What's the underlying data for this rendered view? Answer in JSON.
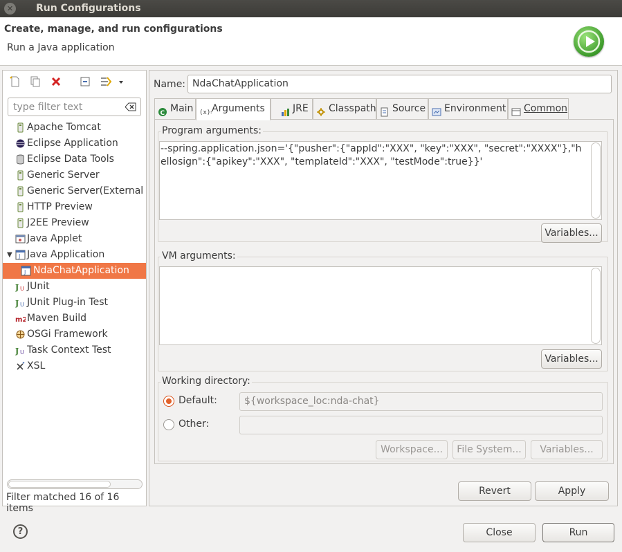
{
  "window": {
    "title": "Run Configurations"
  },
  "header": {
    "title": "Create, manage, and run configurations",
    "subtitle": "Run a Java application",
    "run_icon": "run-icon"
  },
  "left": {
    "toolbar": [
      {
        "name": "new-configuration-icon"
      },
      {
        "name": "duplicate-icon"
      },
      {
        "name": "delete-icon"
      },
      {
        "name": "collapse-all-icon"
      },
      {
        "name": "filter-icon"
      },
      {
        "name": "dropdown-arrow-icon"
      }
    ],
    "filter_placeholder": "type filter text",
    "tree": [
      {
        "label": "Apache Tomcat",
        "icon": "tomcat-icon"
      },
      {
        "label": "Eclipse Application",
        "icon": "eclipse-icon"
      },
      {
        "label": "Eclipse Data Tools",
        "icon": "database-icon"
      },
      {
        "label": "Generic Server",
        "icon": "server-icon"
      },
      {
        "label": "Generic Server(External L",
        "icon": "server-icon"
      },
      {
        "label": "HTTP Preview",
        "icon": "server-icon"
      },
      {
        "label": "J2EE Preview",
        "icon": "server-icon"
      },
      {
        "label": "Java Applet",
        "icon": "applet-icon"
      },
      {
        "label": "Java Application",
        "icon": "java-app-icon",
        "expanded": true
      },
      {
        "label": "NdaChatApplication",
        "icon": "java-app-icon",
        "selected": true,
        "child": true
      },
      {
        "label": "JUnit",
        "icon": "junit-icon"
      },
      {
        "label": "JUnit Plug-in Test",
        "icon": "junit-plugin-icon"
      },
      {
        "label": "Maven Build",
        "icon": "maven-icon"
      },
      {
        "label": "OSGi Framework",
        "icon": "osgi-icon"
      },
      {
        "label": "Task Context Test",
        "icon": "junit-task-icon"
      },
      {
        "label": "XSL",
        "icon": "xsl-icon"
      }
    ],
    "status": "Filter matched 16 of 16 items"
  },
  "right": {
    "name_label": "Name:",
    "name_value": "NdaChatApplication",
    "tabs": [
      {
        "label": "Main",
        "icon": "main-icon"
      },
      {
        "label": "Arguments",
        "icon": "arguments-icon",
        "active": true
      },
      {
        "label": "JRE",
        "icon": "jre-icon"
      },
      {
        "label": "Classpath",
        "icon": "classpath-icon"
      },
      {
        "label": "Source",
        "icon": "source-icon"
      },
      {
        "label": "Environment",
        "icon": "environment-icon"
      },
      {
        "label": "Common",
        "icon": "common-icon"
      }
    ],
    "program_args": {
      "title": "Program arguments:",
      "value": "--spring.application.json='{\"pusher\":{\"appId\":\"XXX\", \"key\":\"XXX\", \"secret\":\"XXXX\"},\"hellosign\":{\"apikey\":\"XXX\", \"templateId\":\"XXX\", \"testMode\":true}}'",
      "variables_button": "Variables..."
    },
    "vm_args": {
      "title": "VM arguments:",
      "value": "",
      "variables_button": "Variables..."
    },
    "working_dir": {
      "title": "Working directory:",
      "default_label": "Default:",
      "default_value": "${workspace_loc:nda-chat}",
      "default_selected": true,
      "other_label": "Other:",
      "other_value": "",
      "workspace_button": "Workspace...",
      "filesystem_button": "File System...",
      "variables_button": "Variables..."
    },
    "revert_button": "Revert",
    "apply_button": "Apply"
  },
  "footer": {
    "help_label": "?",
    "close_button": "Close",
    "run_button": "Run"
  },
  "colors": {
    "selection": "#f07746",
    "title_bar": "#3c3b37",
    "radio_accent": "#e2622a",
    "run_green": "#3d9a2b"
  }
}
